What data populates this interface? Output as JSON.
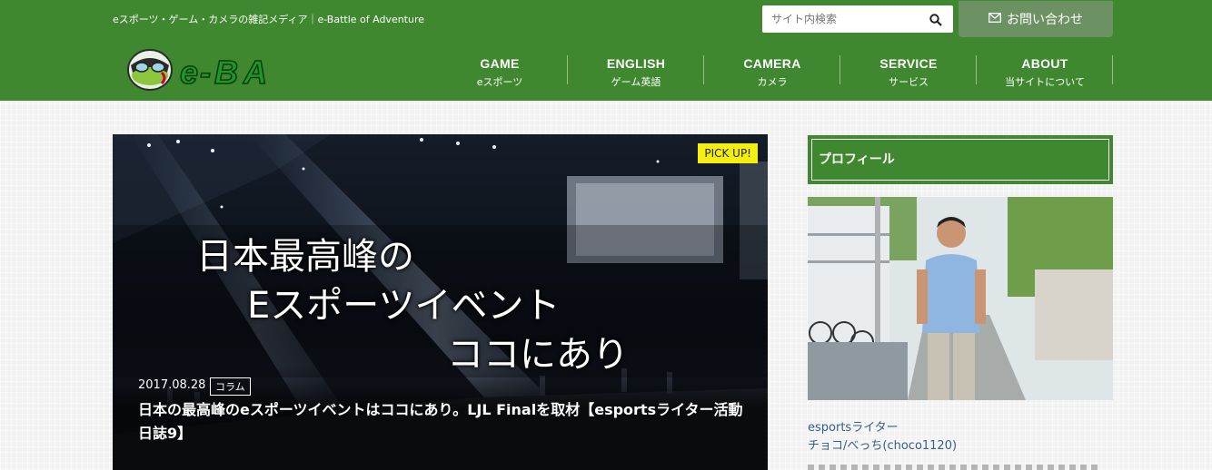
{
  "header": {
    "tagline": "eスポーツ・ゲーム・カメラの雑記メディア｜e-Battle of Adventure",
    "search_placeholder": "サイト内検索",
    "contact_label": "お問い合わせ",
    "logo_text": "e-BA",
    "nav": [
      {
        "en": "GAME",
        "jp": "eスポーツ"
      },
      {
        "en": "ENGLISH",
        "jp": "ゲーム英語"
      },
      {
        "en": "CAMERA",
        "jp": "カメラ"
      },
      {
        "en": "SERVICE",
        "jp": "サービス"
      },
      {
        "en": "ABOUT",
        "jp": "当サイトについて"
      }
    ]
  },
  "featured": {
    "badge": "PICK UP!",
    "overlay_lines": [
      "日本最高峰の",
      "Eスポーツイベント",
      "ココにあり"
    ],
    "date": "2017.08.28",
    "category": "コラム",
    "title": "日本の最高峰のeスポーツイベントはココにあり。LJL Finalを取材【esportsライター活動日誌9】"
  },
  "sidebar": {
    "heading": "プロフィール",
    "role": "esportsライター",
    "name": "チョコ/べっち(choco1120)"
  },
  "colors": {
    "header_green": "#40882f",
    "contact_bg": "#6c9163",
    "pickup_yellow": "#f4ef10",
    "link_blue": "#355e8a"
  }
}
